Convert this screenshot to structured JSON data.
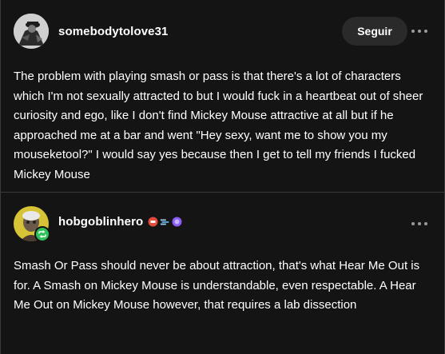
{
  "posts": [
    {
      "username": "somebodytolove31",
      "follow_label": "Seguir",
      "more_icon": "more-dots-icon",
      "text": "The problem with playing smash or pass is that there's a lot of characters which I'm not sexually attracted to but I would fuck in a heartbeat out of sheer curiosity and ego, like I don't find Mickey Mouse attractive at all but if he approached me at a bar and went \"Hey sexy, want me to show you my mouseketool?\" I would say yes because then I get to tell my friends I fucked Mickey Mouse"
    },
    {
      "username": "hobgoblinhero",
      "more_icon": "more-dots-icon",
      "reblog_icon": "reblog-icon",
      "badge_icons": [
        "red-badge-icon",
        "blue-badge-icon",
        "purple-badge-icon"
      ],
      "text": "Smash Or Pass should never be about attraction, that's what Hear Me Out is for. A Smash on Mickey Mouse is understandable, even respectable. A Hear Me Out on Mickey Mouse however, that requires a lab dissection"
    }
  ],
  "colors": {
    "background": "#141414",
    "border": "#3a3a3a",
    "button_bg": "#2a2a2a",
    "reblog_green": "#2ec05a",
    "text": "#ffffff",
    "muted": "#9a9a9a"
  }
}
